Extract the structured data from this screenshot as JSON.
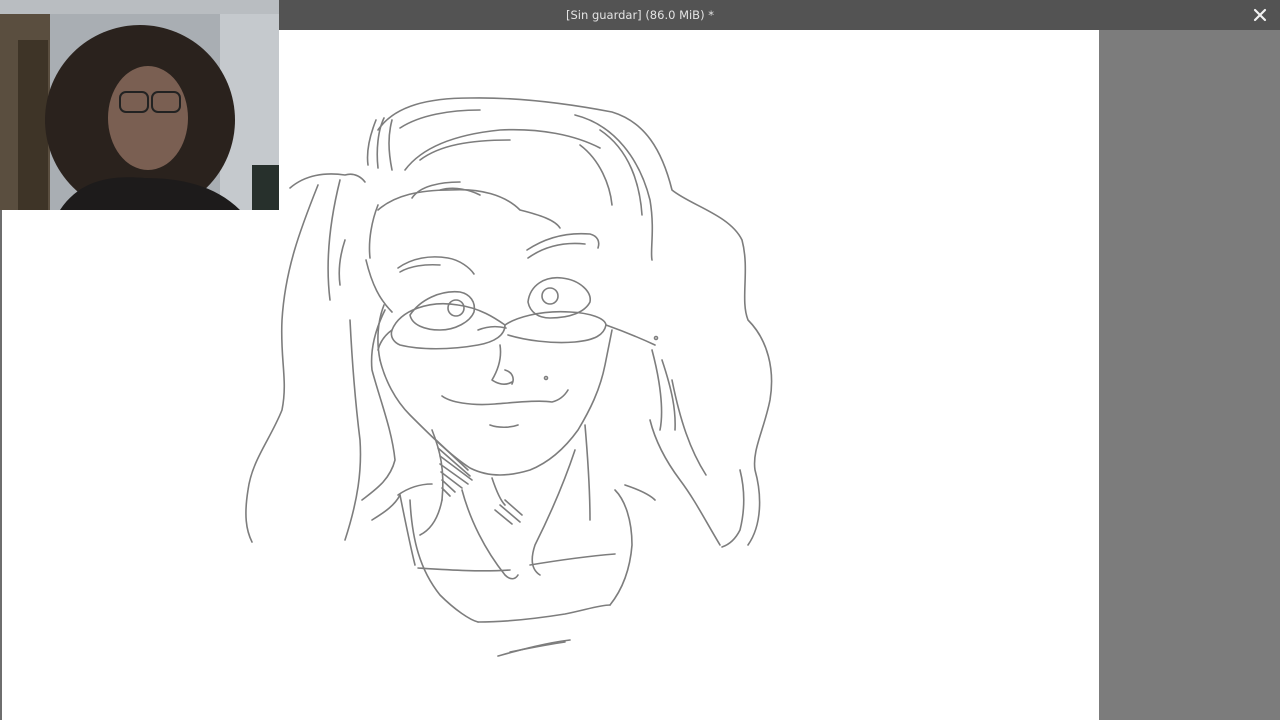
{
  "window": {
    "title": "[Sin guardar]  (86.0 MiB) *",
    "close_icon": "close-icon"
  },
  "canvas": {
    "subject": "sketch-drawing"
  },
  "webcam": {
    "icon": "webcam-overlay"
  },
  "colors": {
    "titlebar": "#535353",
    "canvas": "#ffffff",
    "side_panel": "#7c7c7c",
    "stroke": "#7a7a7a"
  }
}
